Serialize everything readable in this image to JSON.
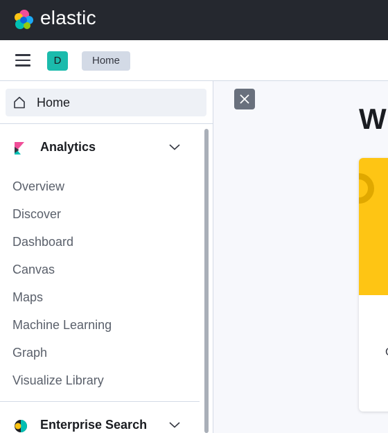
{
  "header": {
    "brand": "elastic",
    "logo_icon": "elastic-cluster-logo"
  },
  "subheader": {
    "space_avatar": "D",
    "breadcrumb": "Home"
  },
  "nav": {
    "home_label": "Home",
    "groups": [
      {
        "label": "Analytics",
        "icon": "kibana-icon",
        "links": [
          "Overview",
          "Discover",
          "Dashboard",
          "Canvas",
          "Maps",
          "Machine Learning",
          "Graph",
          "Visualize Library"
        ]
      },
      {
        "label": "Enterprise Search",
        "icon": "enterprise-search-icon",
        "links": []
      }
    ]
  },
  "main": {
    "title_partial": "W",
    "card_text_partial": "C"
  },
  "colors": {
    "topbar": "#25282f",
    "accent_teal": "#1bbbac",
    "card_yellow": "#fec514"
  }
}
